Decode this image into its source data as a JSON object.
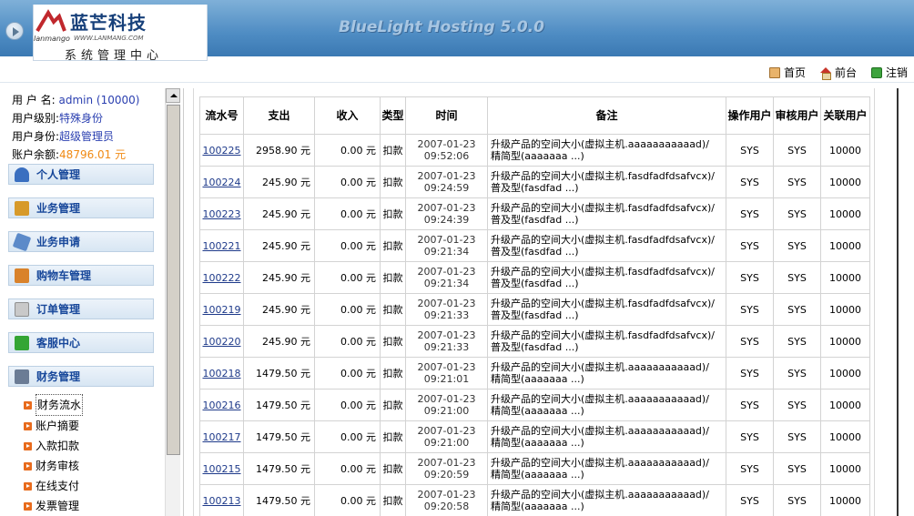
{
  "header": {
    "logo_name": "蓝芒科技",
    "logo_en": "lanmango",
    "logo_url": "WWW.LANMANG.COM",
    "logo_sub": "系统管理中心",
    "app_title": "BlueLight Hosting 5.0.0",
    "colors": {
      "band": "#4e8cc3",
      "logo_red": "#c0282d",
      "logo_blue": "#17407a"
    }
  },
  "toplinks": [
    {
      "label": "首页",
      "icon": "home-icon"
    },
    {
      "label": "前台",
      "icon": "frontend-icon"
    },
    {
      "label": "注销",
      "icon": "logout-icon"
    }
  ],
  "user": {
    "name_label": "用 户 名:",
    "name_value": "admin (10000)",
    "level_label": "用户级别:",
    "level_value": "特殊身份",
    "role_label": "用户身份:",
    "role_value": "超级管理员",
    "balance_label": "账户余额:",
    "balance_value": "48796.01 元"
  },
  "menu": [
    {
      "label": "个人管理",
      "icon": "person-icon",
      "color": "#3a6fc0"
    },
    {
      "label": "业务管理",
      "icon": "box-icon",
      "color": "#d79a2a"
    },
    {
      "label": "业务申请",
      "icon": "pen-icon",
      "color": "#5c8ac9"
    },
    {
      "label": "购物车管理",
      "icon": "cart-icon",
      "color": "#d9822b"
    },
    {
      "label": "订单管理",
      "icon": "clipboard-icon",
      "color": "#8f8f8f"
    },
    {
      "label": "客服中心",
      "icon": "check-icon",
      "color": "#34a534"
    },
    {
      "label": "财务管理",
      "icon": "wrench-icon",
      "color": "#6b7c95"
    }
  ],
  "submenu": [
    "财务流水",
    "账户摘要",
    "入款扣款",
    "财务审核",
    "在线支付",
    "发票管理"
  ],
  "table": {
    "headers": [
      "流水号",
      "支出",
      "收入",
      "类型",
      "时间",
      "备注",
      "操作用户",
      "审核用户",
      "关联用户"
    ],
    "rows": [
      {
        "id": "100225",
        "out": "2958.90 元",
        "in": "0.00  元",
        "type": "扣款",
        "date": "2007-01-23",
        "time": "09:52:06",
        "note1": " 升级产品的空间大小(虚拟主机.aaaaaaaaaaad)/",
        "note2": "精简型(aaaaaaa ...)",
        "op": "SYS",
        "audit": "SYS",
        "rel": "10000"
      },
      {
        "id": "100224",
        "out": "245.90 元",
        "in": "0.00  元",
        "type": "扣款",
        "date": "2007-01-23",
        "time": "09:24:59",
        "note1": " 升级产品的空间大小(虚拟主机.fasdfadfdsafvcx)/",
        "note2": "普及型(fasdfad ...)",
        "op": "SYS",
        "audit": "SYS",
        "rel": "10000"
      },
      {
        "id": "100223",
        "out": "245.90 元",
        "in": "0.00  元",
        "type": "扣款",
        "date": "2007-01-23",
        "time": "09:24:39",
        "note1": " 升级产品的空间大小(虚拟主机.fasdfadfdsafvcx)/",
        "note2": "普及型(fasdfad ...)",
        "op": "SYS",
        "audit": "SYS",
        "rel": "10000"
      },
      {
        "id": "100221",
        "out": "245.90 元",
        "in": "0.00  元",
        "type": "扣款",
        "date": "2007-01-23",
        "time": "09:21:34",
        "note1": " 升级产品的空间大小(虚拟主机.fasdfadfdsafvcx)/",
        "note2": "普及型(fasdfad ...)",
        "op": "SYS",
        "audit": "SYS",
        "rel": "10000"
      },
      {
        "id": "100222",
        "out": "245.90 元",
        "in": "0.00  元",
        "type": "扣款",
        "date": "2007-01-23",
        "time": "09:21:34",
        "note1": " 升级产品的空间大小(虚拟主机.fasdfadfdsafvcx)/",
        "note2": "普及型(fasdfad ...)",
        "op": "SYS",
        "audit": "SYS",
        "rel": "10000"
      },
      {
        "id": "100219",
        "out": "245.90 元",
        "in": "0.00  元",
        "type": "扣款",
        "date": "2007-01-23",
        "time": "09:21:33",
        "note1": " 升级产品的空间大小(虚拟主机.fasdfadfdsafvcx)/",
        "note2": "普及型(fasdfad ...)",
        "op": "SYS",
        "audit": "SYS",
        "rel": "10000"
      },
      {
        "id": "100220",
        "out": "245.90 元",
        "in": "0.00  元",
        "type": "扣款",
        "date": "2007-01-23",
        "time": "09:21:33",
        "note1": " 升级产品的空间大小(虚拟主机.fasdfadfdsafvcx)/",
        "note2": "普及型(fasdfad ...)",
        "op": "SYS",
        "audit": "SYS",
        "rel": "10000"
      },
      {
        "id": "100218",
        "out": "1479.50 元",
        "in": "0.00  元",
        "type": "扣款",
        "date": "2007-01-23",
        "time": "09:21:01",
        "note1": " 升级产品的空间大小(虚拟主机.aaaaaaaaaaad)/",
        "note2": "精简型(aaaaaaa ...)",
        "op": "SYS",
        "audit": "SYS",
        "rel": "10000"
      },
      {
        "id": "100216",
        "out": "1479.50 元",
        "in": "0.00  元",
        "type": "扣款",
        "date": "2007-01-23",
        "time": "09:21:00",
        "note1": " 升级产品的空间大小(虚拟主机.aaaaaaaaaaad)/",
        "note2": "精简型(aaaaaaa ...)",
        "op": "SYS",
        "audit": "SYS",
        "rel": "10000"
      },
      {
        "id": "100217",
        "out": "1479.50 元",
        "in": "0.00  元",
        "type": "扣款",
        "date": "2007-01-23",
        "time": "09:21:00",
        "note1": " 升级产品的空间大小(虚拟主机.aaaaaaaaaaad)/",
        "note2": "精简型(aaaaaaa ...)",
        "op": "SYS",
        "audit": "SYS",
        "rel": "10000"
      },
      {
        "id": "100215",
        "out": "1479.50 元",
        "in": "0.00  元",
        "type": "扣款",
        "date": "2007-01-23",
        "time": "09:20:59",
        "note1": " 升级产品的空间大小(虚拟主机.aaaaaaaaaaad)/",
        "note2": "精简型(aaaaaaa ...)",
        "op": "SYS",
        "audit": "SYS",
        "rel": "10000"
      },
      {
        "id": "100213",
        "out": "1479.50 元",
        "in": "0.00  元",
        "type": "扣款",
        "date": "2007-01-23",
        "time": "09:20:58",
        "note1": " 升级产品的空间大小(虚拟主机.aaaaaaaaaaad)/",
        "note2": "精简型(aaaaaaa ...)",
        "op": "SYS",
        "audit": "SYS",
        "rel": "10000"
      }
    ]
  }
}
